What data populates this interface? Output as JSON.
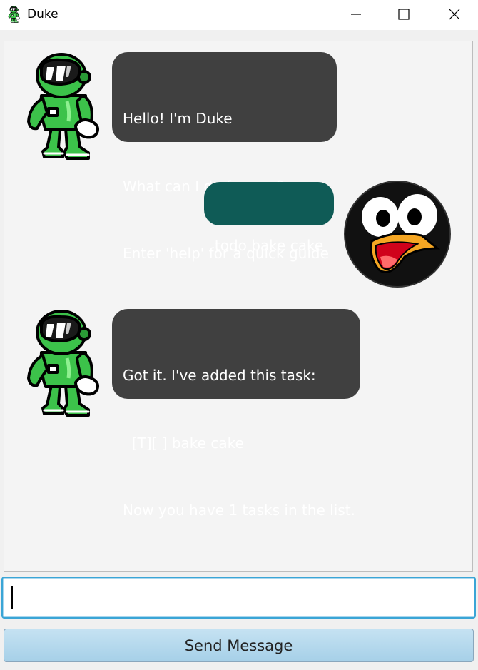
{
  "window": {
    "title": "Duke",
    "icon": "duke-robot-icon",
    "controls": [
      "minimize-icon",
      "maximize-icon",
      "close-icon"
    ]
  },
  "chat": {
    "messages": [
      {
        "sender": "duke",
        "avatar": "duke-robot-avatar",
        "lines": [
          "Hello! I'm Duke",
          "What can I do for you?",
          "Enter 'help' for a quick guide"
        ]
      },
      {
        "sender": "user",
        "avatar": "penguin-avatar",
        "lines": [
          "todo bake cake"
        ]
      },
      {
        "sender": "duke",
        "avatar": "duke-robot-avatar",
        "lines": [
          "Got it. I've added this task:",
          "  [T][ ] bake cake",
          "Now you have 1 tasks in the list."
        ]
      }
    ]
  },
  "input": {
    "value": "",
    "placeholder": ""
  },
  "send_button": {
    "label": "Send Message"
  },
  "colors": {
    "duke_bubble": "#404040",
    "user_bubble": "#0f5b56",
    "input_focus_border": "#3aa5d6",
    "button_gradient_top": "#c5e2f2",
    "button_gradient_bottom": "#a6d0e8"
  }
}
